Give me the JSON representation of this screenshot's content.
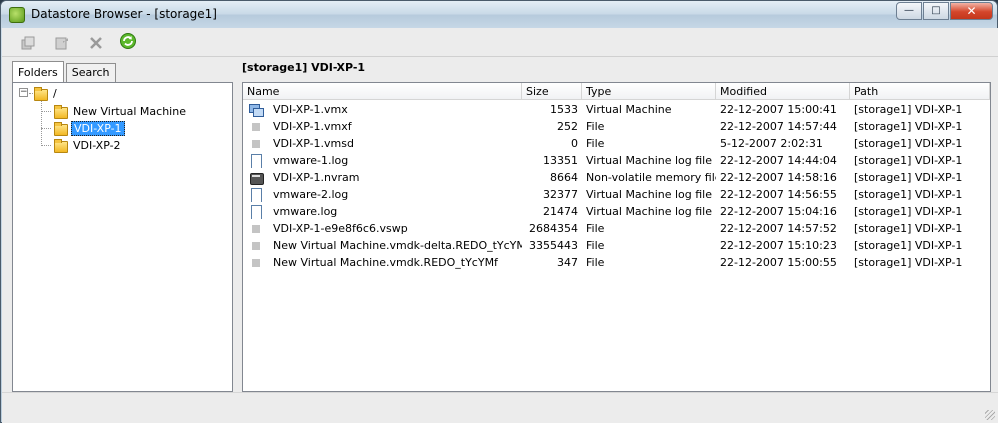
{
  "window": {
    "title": "Datastore Browser - [storage1]",
    "buttons": {
      "minimize": "—",
      "maximize": "□",
      "close": "✕"
    }
  },
  "toolbar": {
    "items": [
      {
        "name": "upload-icon",
        "enabled": false
      },
      {
        "name": "download-icon",
        "enabled": false
      },
      {
        "name": "delete-icon",
        "enabled": false
      },
      {
        "name": "refresh-icon",
        "enabled": true
      }
    ]
  },
  "tabs": [
    {
      "label": "Folders",
      "active": true
    },
    {
      "label": "Search",
      "active": false
    }
  ],
  "tree": {
    "root": "/",
    "items": [
      {
        "label": "New Virtual Machine",
        "selected": false
      },
      {
        "label": "VDI-XP-1",
        "selected": true
      },
      {
        "label": "VDI-XP-2",
        "selected": false
      }
    ]
  },
  "breadcrumb": "[storage1] VDI-XP-1",
  "files": {
    "columns": [
      "Name",
      "Size",
      "Type",
      "Modified",
      "Path"
    ],
    "rows": [
      {
        "icon": "virtual-machine-icon",
        "name": "VDI-XP-1.vmx",
        "size": "1533",
        "type": "Virtual Machine",
        "modified": "22-12-2007 15:00:41",
        "path": "[storage1] VDI-XP-1"
      },
      {
        "icon": "file-icon",
        "name": "VDI-XP-1.vmxf",
        "size": "252",
        "type": "File",
        "modified": "22-12-2007 14:57:44",
        "path": "[storage1] VDI-XP-1"
      },
      {
        "icon": "file-icon",
        "name": "VDI-XP-1.vmsd",
        "size": "0",
        "type": "File",
        "modified": "5-12-2007 2:02:31",
        "path": "[storage1] VDI-XP-1"
      },
      {
        "icon": "log-file-icon",
        "name": "vmware-1.log",
        "size": "13351",
        "type": "Virtual Machine log file",
        "modified": "22-12-2007 14:44:04",
        "path": "[storage1] VDI-XP-1"
      },
      {
        "icon": "memory-file-icon",
        "name": "VDI-XP-1.nvram",
        "size": "8664",
        "type": "Non-volatile memory file",
        "modified": "22-12-2007 14:58:16",
        "path": "[storage1] VDI-XP-1"
      },
      {
        "icon": "log-file-icon",
        "name": "vmware-2.log",
        "size": "32377",
        "type": "Virtual Machine log file",
        "modified": "22-12-2007 14:56:55",
        "path": "[storage1] VDI-XP-1"
      },
      {
        "icon": "log-file-icon",
        "name": "vmware.log",
        "size": "21474",
        "type": "Virtual Machine log file",
        "modified": "22-12-2007 15:04:16",
        "path": "[storage1] VDI-XP-1"
      },
      {
        "icon": "file-icon",
        "name": "VDI-XP-1-e9e8f6c6.vswp",
        "size": "2684354",
        "type": "File",
        "modified": "22-12-2007 14:57:52",
        "path": "[storage1] VDI-XP-1"
      },
      {
        "icon": "file-icon",
        "name": "New Virtual Machine.vmdk-delta.REDO_tYcYMf",
        "size": "3355443",
        "type": "File",
        "modified": "22-12-2007 15:10:23",
        "path": "[storage1] VDI-XP-1"
      },
      {
        "icon": "file-icon",
        "name": "New Virtual Machine.vmdk.REDO_tYcYMf",
        "size": "347",
        "type": "File",
        "modified": "22-12-2007 15:00:55",
        "path": "[storage1] VDI-XP-1"
      }
    ]
  },
  "colors": {
    "selection": "#3399ff",
    "accent_green": "#5a9a1a",
    "close_red": "#d4462b"
  }
}
